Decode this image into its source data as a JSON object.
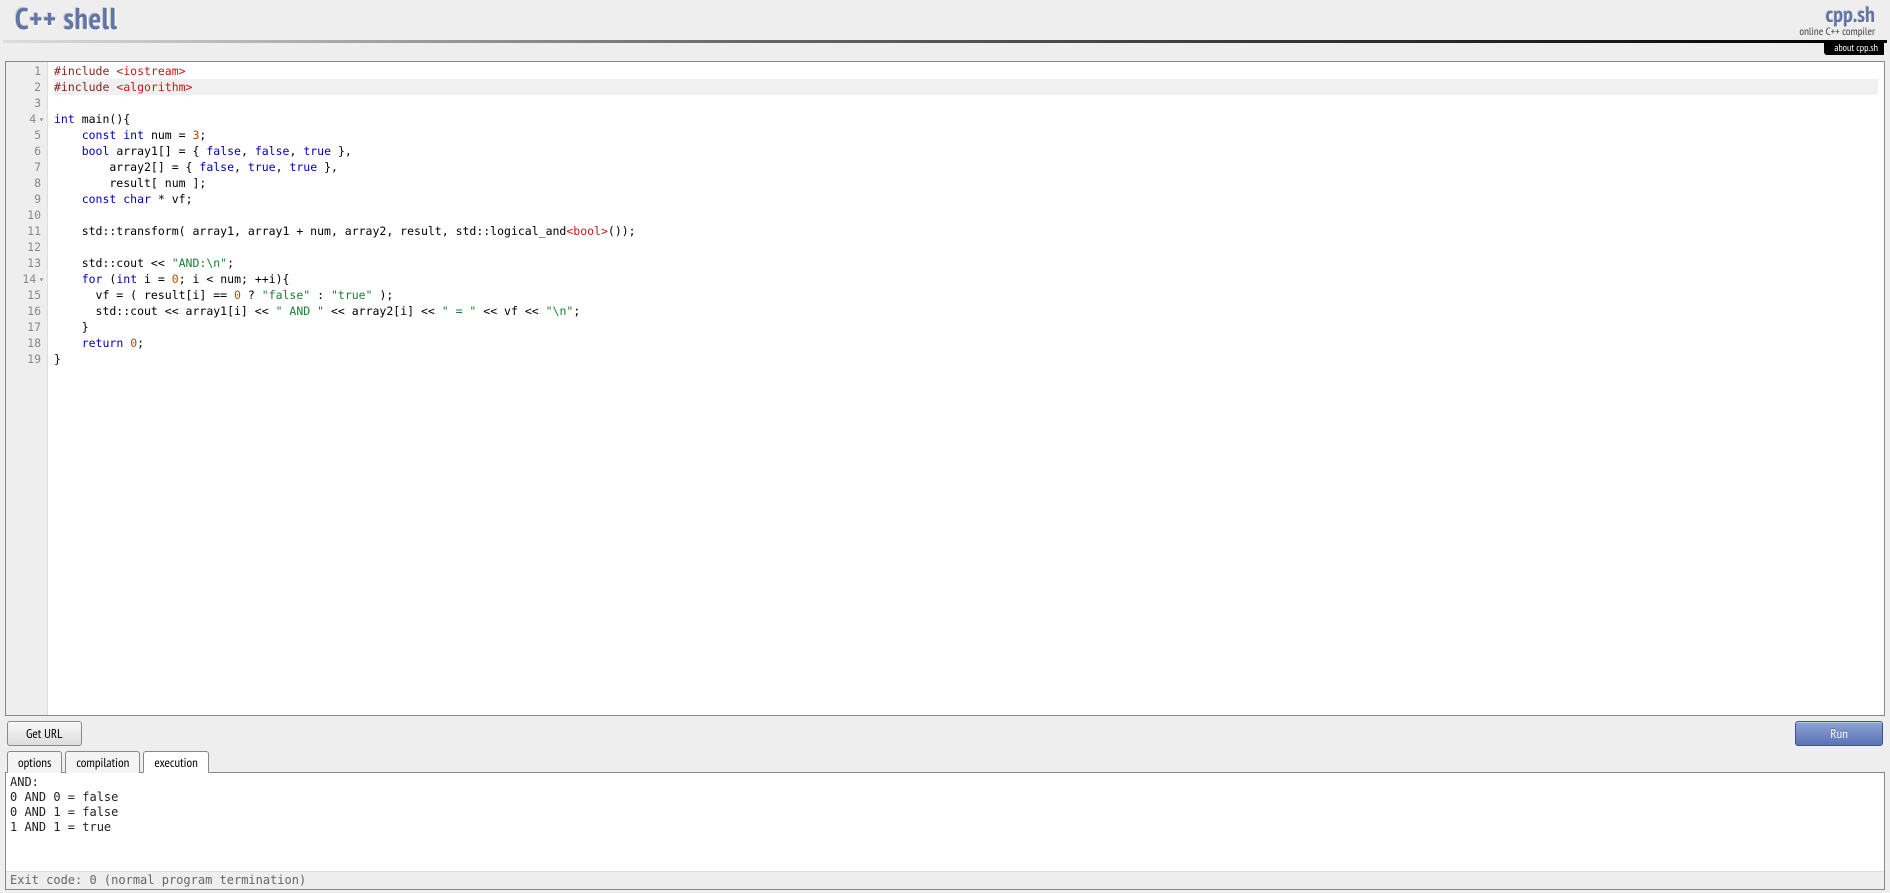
{
  "header": {
    "brand_left": "C++ shell",
    "brand_right": "cpp.sh",
    "brand_sub": "online C++ compiler",
    "about_label": "about cpp.sh"
  },
  "editor": {
    "lines": [
      {
        "n": 1,
        "fold": false,
        "tokens": [
          [
            "s-pre",
            "#include "
          ],
          [
            "s-ang",
            "<iostream>"
          ]
        ]
      },
      {
        "n": 2,
        "fold": false,
        "hl": true,
        "tokens": [
          [
            "s-pre",
            "#include "
          ],
          [
            "s-ang",
            "<algorithm>"
          ]
        ]
      },
      {
        "n": 3,
        "fold": false,
        "tokens": []
      },
      {
        "n": 4,
        "fold": true,
        "tokens": [
          [
            "s-kw",
            "int"
          ],
          [
            "",
            " main(){"
          ]
        ]
      },
      {
        "n": 5,
        "fold": false,
        "tokens": [
          [
            "",
            "    "
          ],
          [
            "s-kw",
            "const int"
          ],
          [
            "",
            " num = "
          ],
          [
            "s-num",
            "3"
          ],
          [
            "",
            ";"
          ]
        ]
      },
      {
        "n": 6,
        "fold": false,
        "tokens": [
          [
            "",
            "    "
          ],
          [
            "s-kw",
            "bool"
          ],
          [
            "",
            " array1[] = { "
          ],
          [
            "s-bool",
            "false"
          ],
          [
            "",
            ", "
          ],
          [
            "s-bool",
            "false"
          ],
          [
            "",
            ", "
          ],
          [
            "s-bool",
            "true"
          ],
          [
            "",
            " },"
          ]
        ]
      },
      {
        "n": 7,
        "fold": false,
        "tokens": [
          [
            "",
            "        array2[] = { "
          ],
          [
            "s-bool",
            "false"
          ],
          [
            "",
            ", "
          ],
          [
            "s-bool",
            "true"
          ],
          [
            "",
            ", "
          ],
          [
            "s-bool",
            "true"
          ],
          [
            "",
            " },"
          ]
        ]
      },
      {
        "n": 8,
        "fold": false,
        "tokens": [
          [
            "",
            "        result[ num ];"
          ]
        ]
      },
      {
        "n": 9,
        "fold": false,
        "tokens": [
          [
            "",
            "    "
          ],
          [
            "s-kw",
            "const char"
          ],
          [
            "",
            " * vf;"
          ]
        ]
      },
      {
        "n": 10,
        "fold": false,
        "tokens": []
      },
      {
        "n": 11,
        "fold": false,
        "tokens": [
          [
            "",
            "    std::transform( array1, array1 + num, array2, result, std::logical_and"
          ],
          [
            "s-ang",
            "<bool>"
          ],
          [
            "",
            "());"
          ]
        ]
      },
      {
        "n": 12,
        "fold": false,
        "tokens": []
      },
      {
        "n": 13,
        "fold": false,
        "tokens": [
          [
            "",
            "    std::cout << "
          ],
          [
            "s-str",
            "\"AND:\\n\""
          ],
          [
            "",
            ";"
          ]
        ]
      },
      {
        "n": 14,
        "fold": true,
        "tokens": [
          [
            "",
            "    "
          ],
          [
            "s-kw",
            "for"
          ],
          [
            "",
            " ("
          ],
          [
            "s-kw",
            "int"
          ],
          [
            "",
            " i = "
          ],
          [
            "s-num",
            "0"
          ],
          [
            "",
            "; i < num; ++i){"
          ]
        ]
      },
      {
        "n": 15,
        "fold": false,
        "tokens": [
          [
            "",
            "      vf = ( result[i] == "
          ],
          [
            "s-num",
            "0"
          ],
          [
            "",
            " ? "
          ],
          [
            "s-str",
            "\"false\""
          ],
          [
            "",
            " : "
          ],
          [
            "s-str",
            "\"true\""
          ],
          [
            "",
            " );"
          ]
        ]
      },
      {
        "n": 16,
        "fold": false,
        "tokens": [
          [
            "",
            "      std::cout << array1[i] << "
          ],
          [
            "s-str",
            "\" AND \""
          ],
          [
            "",
            " << array2[i] << "
          ],
          [
            "s-str",
            "\" = \""
          ],
          [
            "",
            " << vf << "
          ],
          [
            "s-str",
            "\"\\n\""
          ],
          [
            "",
            ";"
          ]
        ]
      },
      {
        "n": 17,
        "fold": false,
        "tokens": [
          [
            "",
            "    }"
          ]
        ]
      },
      {
        "n": 18,
        "fold": false,
        "tokens": [
          [
            "",
            "    "
          ],
          [
            "s-kw",
            "return"
          ],
          [
            "",
            " "
          ],
          [
            "s-num",
            "0"
          ],
          [
            "",
            ";"
          ]
        ]
      },
      {
        "n": 19,
        "fold": false,
        "tokens": [
          [
            "",
            "}"
          ]
        ]
      }
    ]
  },
  "toolbar": {
    "geturl_label": "Get URL",
    "run_label": "Run"
  },
  "tabs": {
    "items": [
      {
        "label": "options",
        "active": false
      },
      {
        "label": "compilation",
        "active": false
      },
      {
        "label": "execution",
        "active": true
      }
    ]
  },
  "output": {
    "body": "AND:\n0 AND 0 = false\n0 AND 1 = false\n1 AND 1 = true",
    "status": "Exit code: 0 (normal program termination)"
  }
}
